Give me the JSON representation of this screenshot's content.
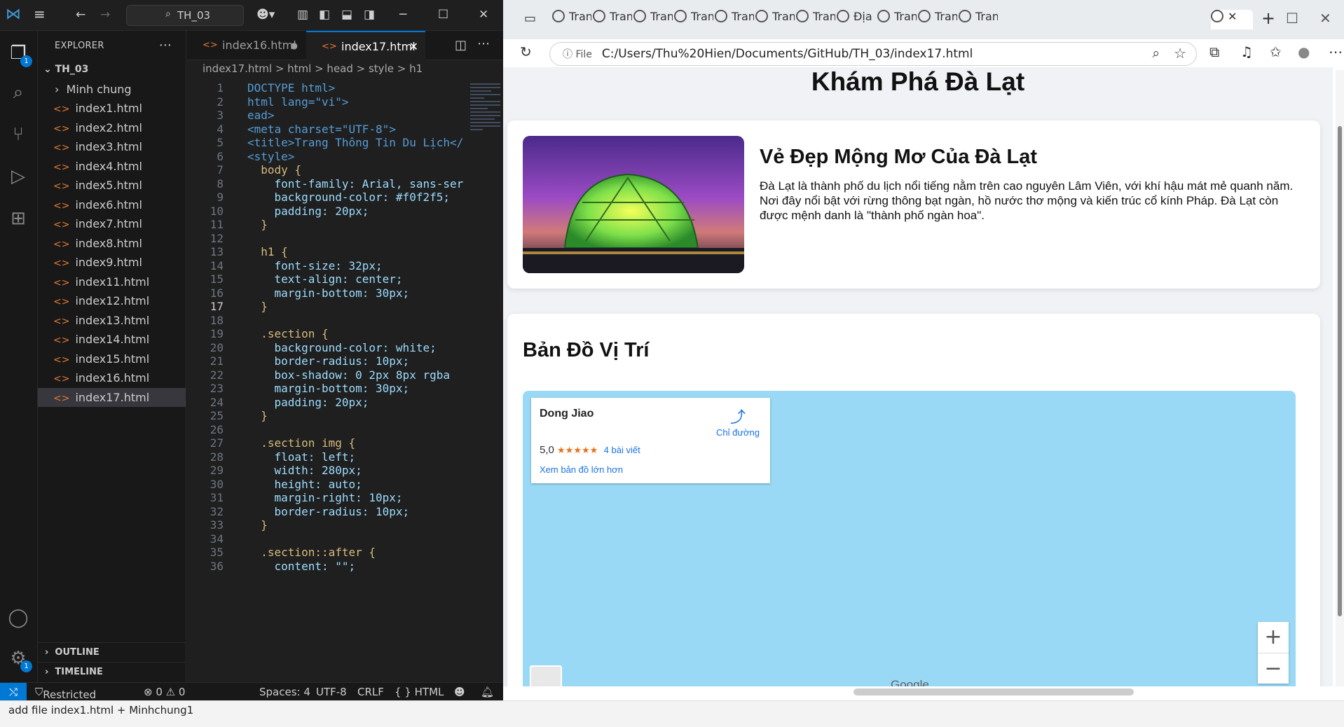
{
  "vscode": {
    "command_center": "TH_03",
    "explorer_title": "EXPLORER",
    "root_folder": "TH_03",
    "folder": "Minh chung",
    "files": [
      "index1.html",
      "index2.html",
      "index3.html",
      "index4.html",
      "index5.html",
      "index6.html",
      "index7.html",
      "index8.html",
      "index9.html",
      "index11.html",
      "index12.html",
      "index13.html",
      "index14.html",
      "index15.html",
      "index16.html",
      "index17.html"
    ],
    "selected_file": "index17.html",
    "outline": "OUTLINE",
    "timeline": "TIMELINE",
    "explorer_badge": "1",
    "settings_badge": "1",
    "tabs": [
      {
        "label": "index16.html",
        "modified": true
      },
      {
        "label": "index17.html",
        "active": true
      }
    ],
    "breadcrumb": "index17.html > html > head > style > h1",
    "code_lines": [
      {
        "n": "1",
        "t": "DOCTYPE html>"
      },
      {
        "n": "2",
        "t": "html lang=\"vi\">"
      },
      {
        "n": "3",
        "t": "ead>"
      },
      {
        "n": "4",
        "t": "<meta charset=\"UTF-8\">"
      },
      {
        "n": "5",
        "t": "<title>Trang Thông Tin Du Lịch</"
      },
      {
        "n": "6",
        "t": "<style>"
      },
      {
        "n": "7",
        "t": "  body {"
      },
      {
        "n": "8",
        "t": "    font-family: Arial, sans-ser"
      },
      {
        "n": "9",
        "t": "    background-color: #f0f2f5;"
      },
      {
        "n": "10",
        "t": "    padding: 20px;"
      },
      {
        "n": "11",
        "t": "  }"
      },
      {
        "n": "12",
        "t": ""
      },
      {
        "n": "13",
        "t": "  h1 {"
      },
      {
        "n": "14",
        "t": "    font-size: 32px;"
      },
      {
        "n": "15",
        "t": "    text-align: center;"
      },
      {
        "n": "16",
        "t": "    margin-bottom: 30px;"
      },
      {
        "n": "17",
        "t": "  }"
      },
      {
        "n": "18",
        "t": ""
      },
      {
        "n": "19",
        "t": "  .section {"
      },
      {
        "n": "20",
        "t": "    background-color: white;"
      },
      {
        "n": "21",
        "t": "    border-radius: 10px;"
      },
      {
        "n": "22",
        "t": "    box-shadow: 0 2px 8px rgba"
      },
      {
        "n": "23",
        "t": "    margin-bottom: 30px;"
      },
      {
        "n": "24",
        "t": "    padding: 20px;"
      },
      {
        "n": "25",
        "t": "  }"
      },
      {
        "n": "26",
        "t": ""
      },
      {
        "n": "27",
        "t": "  .section img {"
      },
      {
        "n": "28",
        "t": "    float: left;"
      },
      {
        "n": "29",
        "t": "    width: 280px;"
      },
      {
        "n": "30",
        "t": "    height: auto;"
      },
      {
        "n": "31",
        "t": "    margin-right: 10px;"
      },
      {
        "n": "32",
        "t": "    border-radius: 10px;"
      },
      {
        "n": "33",
        "t": "  }"
      },
      {
        "n": "34",
        "t": ""
      },
      {
        "n": "35",
        "t": "  .section::after {"
      },
      {
        "n": "36",
        "t": "    content: \"\";"
      }
    ],
    "status": {
      "mode": "Restricted Mode",
      "problems": "⊗ 0 ⚠ 0",
      "spaces": "Spaces: 4",
      "encoding": "UTF-8",
      "eol": "CRLF",
      "language": "{ } HTML"
    }
  },
  "commit_message": "add file index1.html + Minhchung1",
  "browser": {
    "tab_label": "Tran",
    "tab_label_alt": "Địa",
    "address_scheme": "File",
    "url": "C:/Users/Thu%20Hien/Documents/GitHub/TH_03/index17.html",
    "page": {
      "heading": "Khám Phá Đà Lạt",
      "section1_title": "Vẻ Đẹp Mộng Mơ Của Đà Lạt",
      "section1_text": "Đà Lạt là thành phố du lịch nổi tiếng nằm trên cao nguyên Lâm Viên, với khí hậu mát mẻ quanh năm. Nơi đây nổi bật với rừng thông bạt ngàn, hồ nước thơ mộng và kiến trúc cổ kính Pháp. Đà Lạt còn được mệnh danh là \"thành phố ngàn hoa\".",
      "section2_title": "Bản Đồ Vị Trí",
      "map_card": {
        "place": "Dong Jiao",
        "directions": "Chỉ đường",
        "rating": "5,0",
        "stars": "★★★★★",
        "reviews": "4 bài viết",
        "larger_map": "Xem bản đồ lớn hơn"
      },
      "map_logo": "Google"
    }
  }
}
